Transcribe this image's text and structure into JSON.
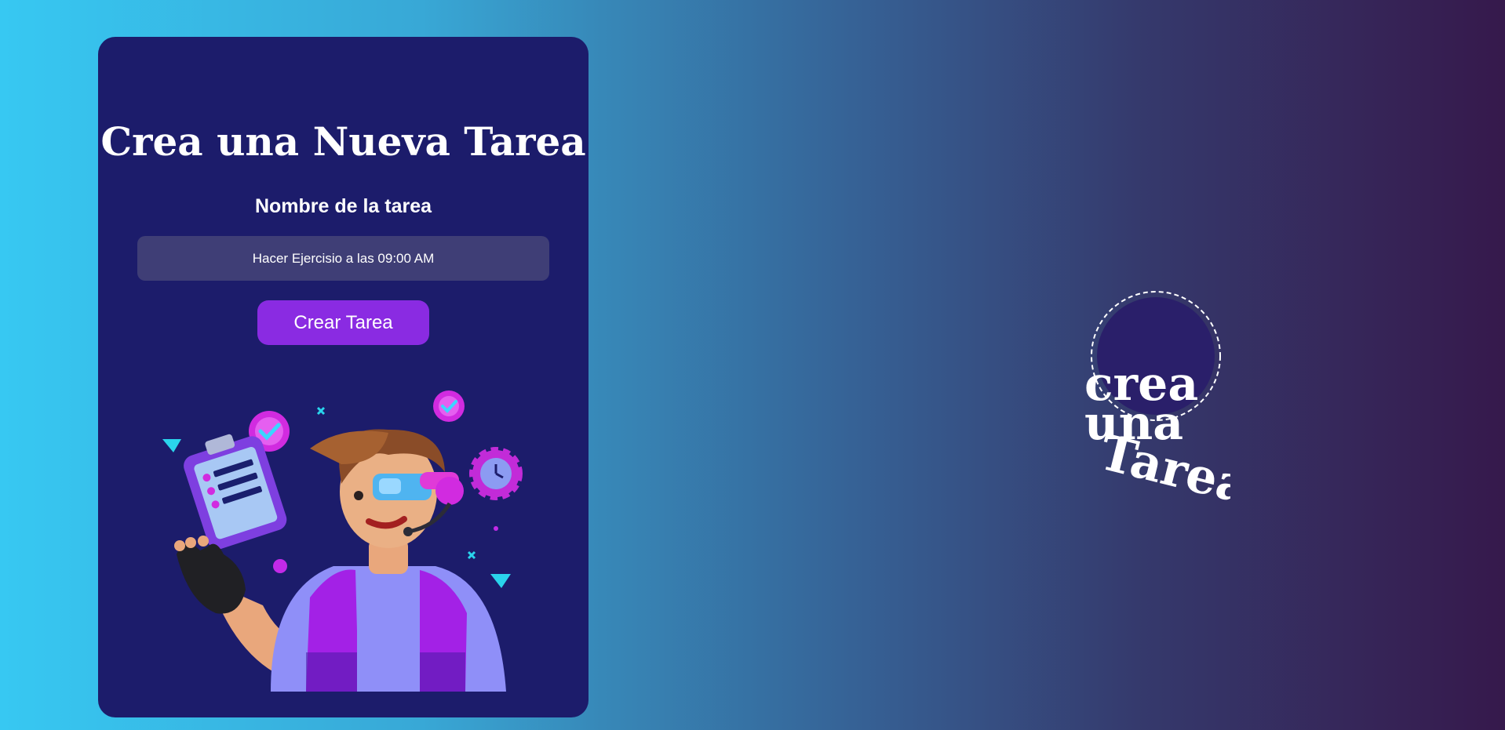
{
  "form": {
    "title": "Crea una Nueva Tarea",
    "field_label": "Nombre de la tarea",
    "task_value": "Hacer Ejercisio a las 09:00 AM",
    "submit_label": "Crear Tarea"
  },
  "logo": {
    "line1": "crea",
    "line2": "una",
    "line3": "Tarea"
  },
  "colors": {
    "card_background": "#1c1c6b",
    "button": "#8a2be2",
    "input_background": "#3f3e76",
    "gradient_start": "#37c8f2",
    "gradient_end": "#36194c"
  },
  "icons": [
    "check-badge-icon",
    "clipboard-icon",
    "clock-gear-icon",
    "triangle-icon",
    "cross-icon",
    "vr-headset-icon",
    "glove-icon"
  ]
}
